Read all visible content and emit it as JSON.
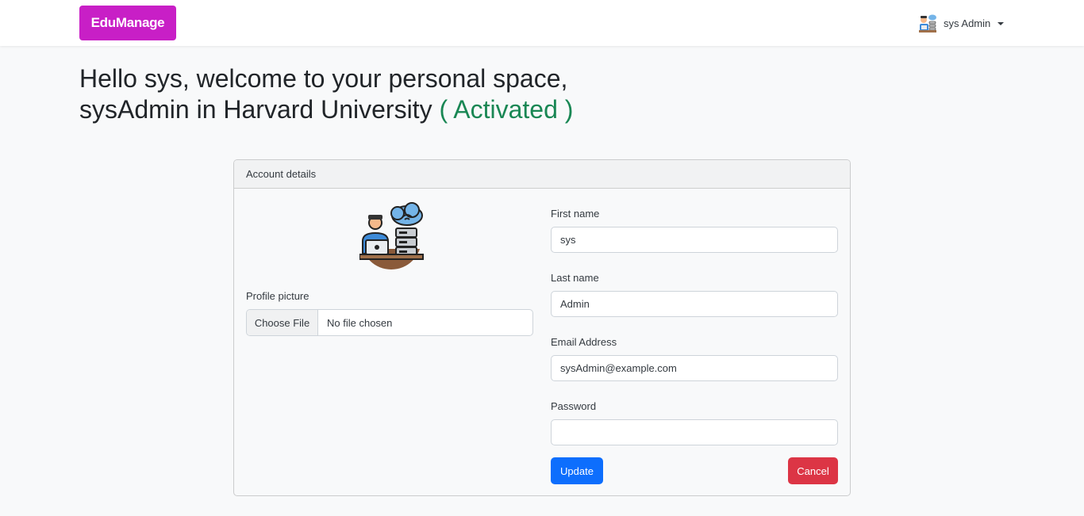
{
  "navbar": {
    "brand": "EduManage",
    "user_name": "sys Admin",
    "avatar_icon": "sysadmin-avatar-icon"
  },
  "greeting": {
    "line1": "Hello sys, welcome to your personal space,",
    "line2": "sysAdmin in Harvard University",
    "status": "( Activated )"
  },
  "card": {
    "header": "Account details",
    "profile_picture_label": "Profile picture",
    "file_button": "Choose File",
    "file_status": "No file chosen",
    "fields": {
      "first_name": {
        "label": "First name",
        "value": "sys"
      },
      "last_name": {
        "label": "Last name",
        "value": "Admin"
      },
      "email": {
        "label": "Email Address",
        "value": "sysAdmin@example.com"
      },
      "password": {
        "label": "Password",
        "value": ""
      }
    },
    "update_label": "Update",
    "cancel_label": "Cancel"
  },
  "colors": {
    "brand": "#c81fc6",
    "status": "#198754",
    "primary": "#0d6efd",
    "danger": "#dc3545"
  }
}
